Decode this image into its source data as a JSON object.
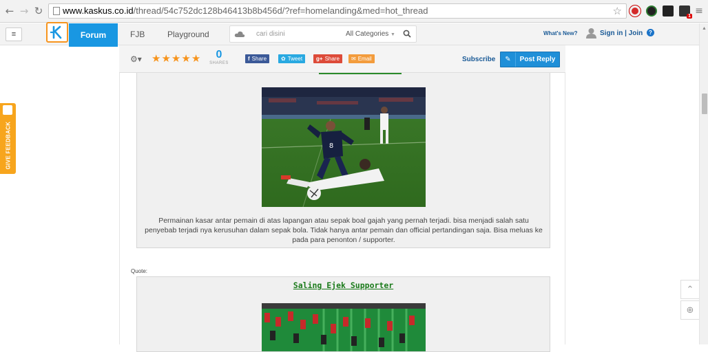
{
  "browser": {
    "url_host": "www.kaskus.co.id",
    "url_rest": "/thread/54c752dc128b46413b8b456d/?ref=homelanding&med=hot_thread",
    "ext_badge": "1"
  },
  "header": {
    "forum_tab": "Forum",
    "fjb_tab": "FJB",
    "playground_tab": "Playground",
    "search_placeholder": "cari disini",
    "category_select": "All Categories",
    "whats_new": "What's New?",
    "sign_in": "Sign in | Join",
    "help": "?"
  },
  "toolbar": {
    "rating_stars": 5,
    "share_count": "0",
    "share_label": "SHARES",
    "facebook_share": "Share",
    "twitter_tweet": "Tweet",
    "gplus_share": "Share",
    "email": "Email",
    "subscribe": "Subscribe",
    "post_reply": "Post Reply"
  },
  "post": {
    "caption": "Permainan kasar antar pemain di atas lapangan atau sepak boal gajah yang pernah terjadi. bisa menjadi salah satu penyebab terjadi nya kerusuhan dalam sepak bola. Tidak hanya antar pemain dan official pertandingan saja. Bisa meluas ke pada para penonton / supporter.",
    "quote_label": "Quote:",
    "quote_title": "Saling Ejek Supporter"
  },
  "sidebar": {
    "feedback_label": "GIVE FEEDBACK"
  },
  "colors": {
    "brand_blue": "#1997e2",
    "accent_orange": "#f7941d",
    "facebook": "#3b5998",
    "twitter": "#29a9e1",
    "gplus": "#dd4b39",
    "email": "#f39c3c",
    "quote_title_green": "#1a7a1a"
  }
}
